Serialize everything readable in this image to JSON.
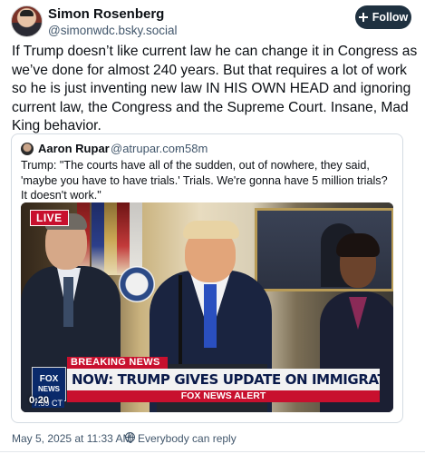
{
  "post": {
    "author": {
      "display_name": "Simon Rosenberg",
      "handle": "@simonwdc.bsky.social"
    },
    "follow_button": {
      "label": "Follow",
      "icon": "plus-icon"
    },
    "text": "If Trump doesn’t like current law he can change it in Congress as we’ve done for almost 240 years.  But that requires a lot of work so he is just inventing new law IN HIS OWN HEAD and ignoring current law, the Congress and the Supreme Court.  Insane, Mad King behavior.",
    "timestamp": "May 5, 2025 at 11:33 AM",
    "reply_setting": "Everybody can reply"
  },
  "quote": {
    "author": {
      "display_name": "Aaron Rupar",
      "handle": "@atrupar.com",
      "separator": "·",
      "time": "58m"
    },
    "text": "Trump: \"The courts have all of the sudden, out of nowhere, they said, 'maybe you have to have trials.' Trials. We're gonna have 5 million trials? It doesn't work.\"",
    "video": {
      "live_badge": "LIVE",
      "network_logo_line1": "FOX",
      "network_logo_line2": "NEWS",
      "breaking_label": "BREAKING NEWS",
      "headline": "NOW: TRUMP GIVES UPDATE ON IMMIGRATION CRACKDOWN",
      "alert_label": "FOX NEWS ALERT",
      "ticker_time": "7:59 CT",
      "playback_time": "0:20"
    }
  },
  "colors": {
    "follow_bg": "#1f3140",
    "fox_red": "#c8102e",
    "fox_blue": "#0a2a6b",
    "muted_text": "#42576c"
  }
}
